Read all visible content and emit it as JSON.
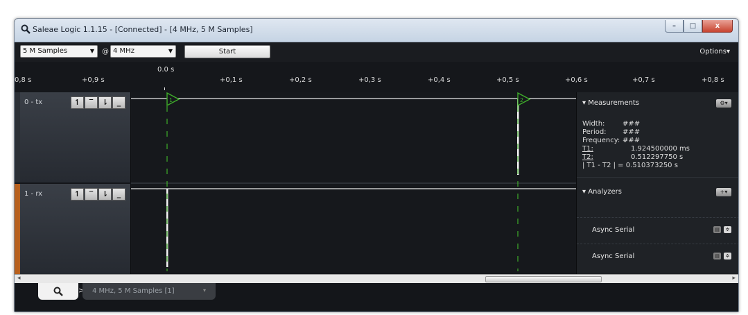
{
  "window": {
    "title": "Saleae Logic 1.1.15 - [Connected] - [4 MHz, 5 M Samples]",
    "controls": {
      "minimize": "–",
      "maximize": "□",
      "close": "x"
    }
  },
  "toolbar": {
    "samples": "5 M Samples",
    "at": "@",
    "rate": "4 MHz",
    "start_label": "Start",
    "options_label": "Options▾"
  },
  "ruler": {
    "zero_label": "0.0 s",
    "ticks": [
      "0,8 s",
      "+0,9 s",
      "+0,1 s",
      "+0,2 s",
      "+0,3 s",
      "+0,4 s",
      "+0,5 s",
      "+0,6 s",
      "+0,7 s",
      "+0,8 s"
    ]
  },
  "channels": [
    {
      "name": "0 - tx",
      "trigger_buttons": [
        "↿",
        "‾",
        "⇂",
        "_"
      ]
    },
    {
      "name": "1 - rx",
      "trigger_buttons": [
        "↿",
        "‾",
        "⇂",
        "_"
      ]
    }
  ],
  "markers": [
    {
      "label": "1"
    },
    {
      "label": "2"
    }
  ],
  "measurements": {
    "header": "▾ Measurements",
    "button": "⚙▾",
    "rows": [
      {
        "key": "Width:",
        "value": "###"
      },
      {
        "key": "Period:",
        "value": "###"
      },
      {
        "key": "Frequency:",
        "value": "###"
      },
      {
        "key": "T1:",
        "value": "1.924500000 ms"
      },
      {
        "key": "T2:",
        "value": "0.512297750 s"
      }
    ],
    "diff": "| T1 - T2 | = 0.510373250 s"
  },
  "analyzers": {
    "header": "▾ Analyzers",
    "button": "+▾",
    "items": [
      {
        "label": "Async Serial"
      },
      {
        "label": "Async Serial"
      }
    ]
  },
  "scrollbar": {
    "left_arrow": "◂",
    "right_arrow": "▸"
  },
  "tabs": {
    "arrow": ">",
    "session_label": "4 MHz, 5 M Samples [1]",
    "session_chevron": "▾"
  },
  "colors": {
    "marker_green": "#3fae2a",
    "rx_accent": "#b8601d",
    "signal_white": "#e8e8e8"
  }
}
